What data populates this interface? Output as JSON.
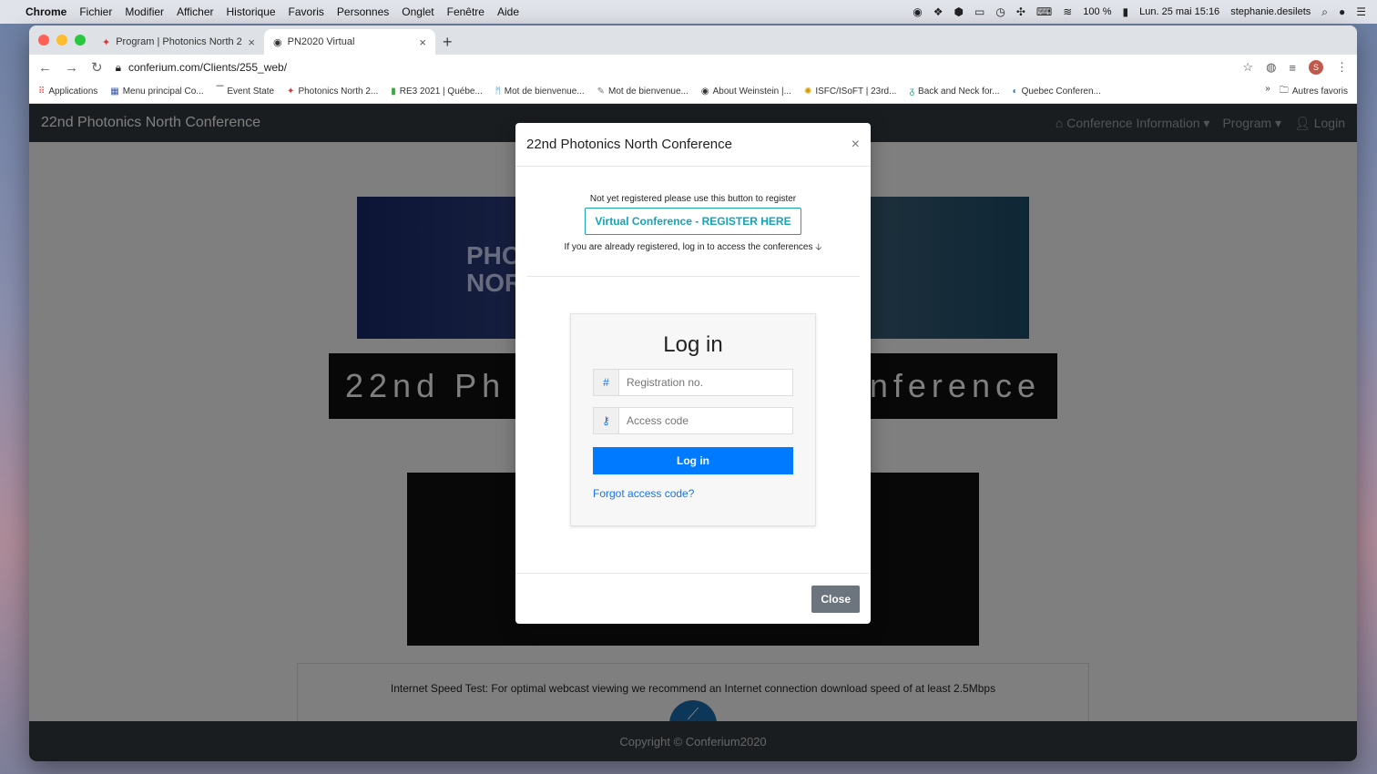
{
  "menubar": {
    "app": "Chrome",
    "items": [
      "Fichier",
      "Modifier",
      "Afficher",
      "Historique",
      "Favoris",
      "Personnes",
      "Onglet",
      "Fenêtre",
      "Aide"
    ],
    "battery": "100 %",
    "datetime": "Lun. 25 mai 15:16",
    "user": "stephanie.desilets"
  },
  "tabs": [
    {
      "title": "Program | Photonics North 202"
    },
    {
      "title": "PN2020 Virtual"
    }
  ],
  "toolbar": {
    "url": "conferium.com/Clients/255_web/",
    "avatar_letter": "S"
  },
  "bookmarks": {
    "items": [
      "Applications",
      "Menu principal Co...",
      "Event State",
      "Photonics North 2...",
      "RE3 2021 | Québe...",
      "Mot de bienvenue...",
      "Mot de bienvenue...",
      "About Weinstein |...",
      "ISFC/ISoFT | 23rd...",
      "Back and Neck for...",
      "Quebec Conferen..."
    ],
    "more": "»",
    "other": "Autres favoris"
  },
  "site": {
    "brand": "22nd Photonics North Conference",
    "nav": {
      "info": "Conference Information",
      "program": "Program",
      "login": "Login"
    },
    "banner_text_line1": "PHOT",
    "banner_text_line2": "NORT",
    "title_left": "22nd Ph",
    "title_right": "nference",
    "speed_text": "Internet Speed Test: For optimal webcast viewing we recommend an Internet connection download speed of at least 2.5Mbps",
    "footer": "Copyright © Conferium2020"
  },
  "modal": {
    "title": "22nd Photonics North Conference",
    "reg_note": "Not yet registered please use this button to register",
    "register_label": "Virtual Conference - REGISTER HERE",
    "login_note": "If you are already registered, log in to access the conferences",
    "login_heading": "Log in",
    "registration_placeholder": "Registration no.",
    "access_placeholder": "Access code",
    "login_button": "Log in",
    "forgot": "Forgot access code?",
    "close": "Close"
  }
}
